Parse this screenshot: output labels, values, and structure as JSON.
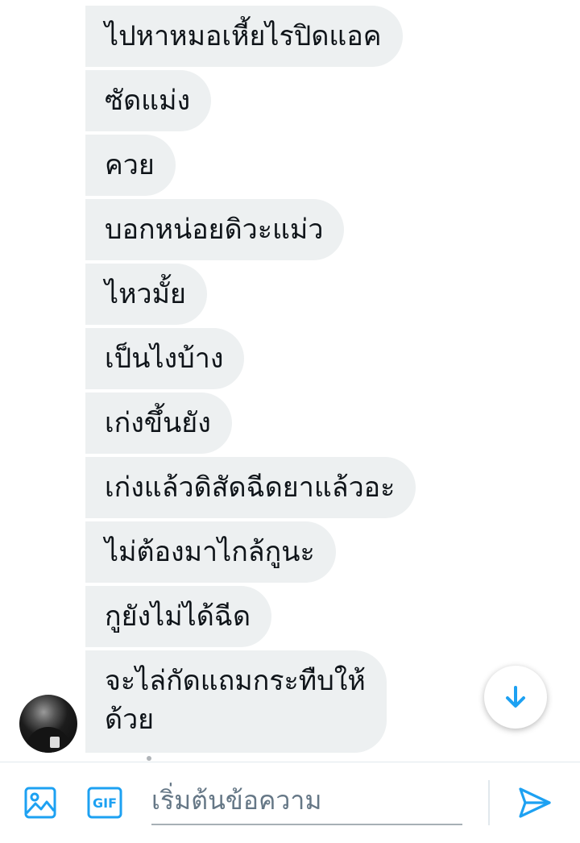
{
  "conversation": {
    "messages": [
      {
        "text": "ไปหาหมอเหี้ยไรปิดแอค"
      },
      {
        "text": "ซัดแม่ง"
      },
      {
        "text": "ควย"
      },
      {
        "text": "บอกหน่อยดิวะแม่ว"
      },
      {
        "text": "ไหวมั้ย"
      },
      {
        "text": "เป็นไงบ้าง"
      },
      {
        "text": "เก่งขึ้นยัง"
      },
      {
        "text": "เก่งแล้วดิสัดฉีดยาแล้วอะ"
      },
      {
        "text": "ไม่ต้องมาไกล้กูนะ"
      },
      {
        "text": "กูยังไม่ได้ฉีด"
      },
      {
        "text": "จะไล่กัดแถมกระทืบให้\nด้วย"
      }
    ]
  },
  "composer": {
    "placeholder": "เริ่มต้นข้อความ",
    "value": "",
    "gif_label": "GIF"
  },
  "icons": {
    "avatar": "profile-avatar",
    "scroll": "arrow-down-icon",
    "image": "image-icon",
    "gif": "gif-icon",
    "send": "send-icon"
  },
  "colors": {
    "accent": "#1da1f2",
    "bubble": "#edf0f1",
    "text": "#0f1419",
    "placeholder": "#657786"
  }
}
